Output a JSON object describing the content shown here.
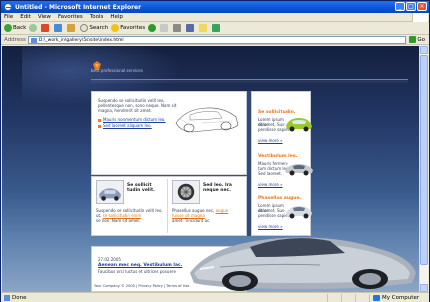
{
  "window": {
    "title": "Untitled - Microsoft Internet Explorer",
    "buttons": [
      "_",
      "□",
      "×"
    ]
  },
  "menu": [
    "File",
    "Edit",
    "View",
    "Favorites",
    "Tools",
    "Help"
  ],
  "toolbar": {
    "back": "Back",
    "search": "Search",
    "favorites": "Favorites"
  },
  "address": {
    "label": "Address",
    "url": "D:\\_work_in\\gallery\\5s\\site\\index.html",
    "go": "Go"
  },
  "site": {
    "tagline": "best professional services",
    "intro": {
      "text": [
        "Suspendo se sollicitudin velit leo,",
        "pellentesque non, sono neque. Nam sit",
        "magna, hendrerit sit amet."
      ],
      "links": [
        "Mauris nonmentum dictum leo.",
        "Sed laoreet aliquam leo."
      ]
    },
    "feature_left": {
      "title": [
        "Se sollicit",
        "tudin velit."
      ],
      "text": [
        "Suspendo se sollicitudin velit leo,",
        "ut, ",
        "se sollicitudin enim",
        "se non. Nam sit amet."
      ],
      "link": "se sollicitudin enim"
    },
    "feature_right": {
      "title": [
        "Sed leo. Ira",
        "neque nec."
      ],
      "text": [
        "Phasellus augue nec,",
        "fuisse sit magna.",
        "Hendrerit sit",
        "amet. Tincidunt ac."
      ],
      "links": [
        "augue",
        "fuisse sit magna"
      ]
    },
    "sidebar": [
      {
        "title": "Se sollicitudin.",
        "text": [
          "Lorem ipsum dolor",
          "sit amet, Sus-",
          "pendisse sapien."
        ],
        "more": "view more »"
      },
      {
        "title": "Vestibulum leo.",
        "text": [
          "Mauris fermen-",
          "tum dictum leo.",
          "Sed laoreet."
        ],
        "more": "view more »"
      },
      {
        "title": "Phasellus augue.",
        "text": [
          "Lorem ipsum dolor",
          "sit amet, Sus-",
          "pendisse sapien."
        ],
        "more": "view more »"
      }
    ],
    "news": {
      "date": "27.02.2005",
      "title": "Aenean mec neq. Vestibulum lac.",
      "text": "Faucibus orci luctus et ultrices posuere"
    },
    "copyright": "Your Company © 2005 | Privacy Policy | Terms of Use"
  },
  "status": {
    "text": "Done",
    "zone": "My Computer"
  },
  "colors": {
    "accent": "#e8761a",
    "link": "#1c3f9e",
    "titlebar": "#0a55d8"
  }
}
